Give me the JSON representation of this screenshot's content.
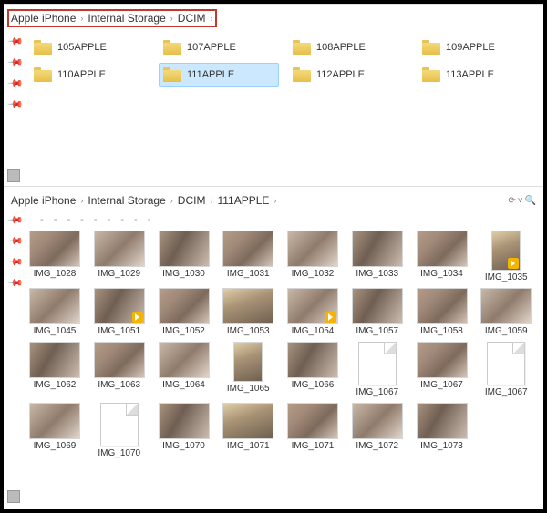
{
  "top": {
    "breadcrumb": [
      "Apple iPhone",
      "Internal Storage",
      "DCIM"
    ],
    "folders": [
      {
        "name": "105APPLE",
        "selected": false
      },
      {
        "name": "107APPLE",
        "selected": false
      },
      {
        "name": "108APPLE",
        "selected": false
      },
      {
        "name": "109APPLE",
        "selected": false
      },
      {
        "name": "110APPLE",
        "selected": false
      },
      {
        "name": "111APPLE",
        "selected": true
      },
      {
        "name": "112APPLE",
        "selected": false
      },
      {
        "name": "113APPLE",
        "selected": false
      }
    ]
  },
  "bottom": {
    "breadcrumb": [
      "Apple iPhone",
      "Internal Storage",
      "DCIM",
      "111APPLE"
    ],
    "searchGlyph": "🔍",
    "rows": [
      [
        {
          "name": "IMG_1028",
          "kind": "photo",
          "v": 1
        },
        {
          "name": "IMG_1029",
          "kind": "photo",
          "v": 2
        },
        {
          "name": "IMG_1030",
          "kind": "photo",
          "v": 3
        },
        {
          "name": "IMG_1031",
          "kind": "photo",
          "v": 1
        },
        {
          "name": "IMG_1032",
          "kind": "photo",
          "v": 2
        },
        {
          "name": "IMG_1033",
          "kind": "photo",
          "v": 3
        },
        {
          "name": "IMG_1034",
          "kind": "photo",
          "v": 1
        },
        {
          "name": "IMG_1035",
          "kind": "video-portrait",
          "v": 4
        }
      ],
      [
        {
          "name": "IMG_1045",
          "kind": "photo",
          "v": 2
        },
        {
          "name": "IMG_1051",
          "kind": "video",
          "v": 3
        },
        {
          "name": "IMG_1052",
          "kind": "photo",
          "v": 1
        },
        {
          "name": "IMG_1053",
          "kind": "photo",
          "v": 4
        },
        {
          "name": "IMG_1054",
          "kind": "video",
          "v": 2
        },
        {
          "name": "IMG_1057",
          "kind": "photo",
          "v": 3
        },
        {
          "name": "IMG_1058",
          "kind": "photo",
          "v": 1
        },
        {
          "name": "IMG_1059",
          "kind": "photo",
          "v": 2
        }
      ],
      [
        {
          "name": "IMG_1062",
          "kind": "photo",
          "v": 3
        },
        {
          "name": "IMG_1063",
          "kind": "photo",
          "v": 1
        },
        {
          "name": "IMG_1064",
          "kind": "photo",
          "v": 2
        },
        {
          "name": "IMG_1065",
          "kind": "photo-portrait",
          "v": 4
        },
        {
          "name": "IMG_1066",
          "kind": "photo",
          "v": 3
        },
        {
          "name": "IMG_1067",
          "kind": "blank",
          "v": 0
        },
        {
          "name": "IMG_1067",
          "kind": "photo",
          "v": 1
        },
        {
          "name": "IMG_1067",
          "kind": "blank",
          "v": 0
        }
      ],
      [
        {
          "name": "IMG_1069",
          "kind": "photo",
          "v": 2
        },
        {
          "name": "IMG_1070",
          "kind": "blank",
          "v": 0
        },
        {
          "name": "IMG_1070",
          "kind": "photo",
          "v": 3
        },
        {
          "name": "IMG_1071",
          "kind": "photo",
          "v": 4
        },
        {
          "name": "IMG_1071",
          "kind": "photo",
          "v": 1
        },
        {
          "name": "IMG_1072",
          "kind": "photo",
          "v": 2
        },
        {
          "name": "IMG_1073",
          "kind": "photo",
          "v": 3
        },
        {
          "name": "",
          "kind": "empty",
          "v": 0
        }
      ]
    ]
  }
}
